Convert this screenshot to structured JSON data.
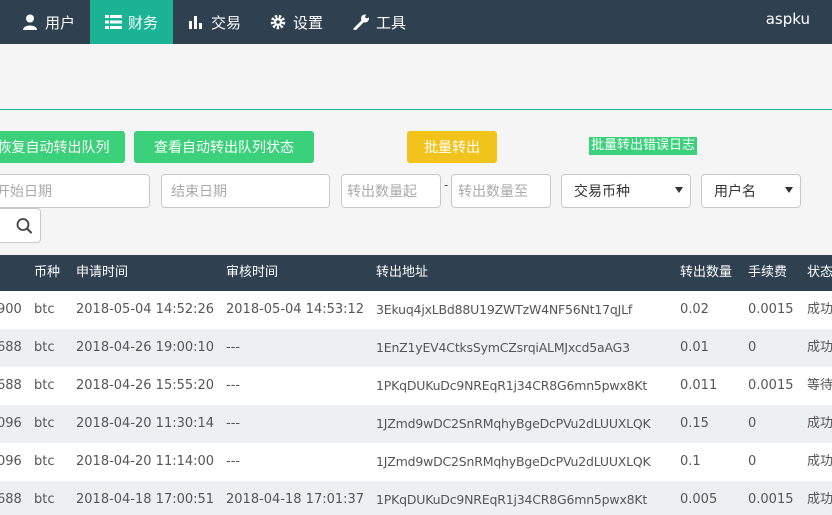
{
  "nav": {
    "items": [
      {
        "label": "用户",
        "icon": "user-icon"
      },
      {
        "label": "财务",
        "icon": "list-icon",
        "active": true
      },
      {
        "label": "交易",
        "icon": "bar-chart-icon"
      },
      {
        "label": "设置",
        "icon": "gear-icon"
      },
      {
        "label": "工具",
        "icon": "wrench-icon"
      }
    ],
    "user": "aspku"
  },
  "toolbar": {
    "resume_queue": "恢复自动转出队列",
    "view_queue_status": "查看自动转出队列状态",
    "batch_transfer": "批量转出",
    "batch_error_log": "批量转出错误日志"
  },
  "filters": {
    "start_date_placeholder": "开始日期",
    "end_date_placeholder": "结束日期",
    "amount_from_placeholder": "转出数量起",
    "amount_to_placeholder": "转出数量至",
    "range_dash": "-",
    "coin_select": "交易币种",
    "user_select": "用户名"
  },
  "colors": {
    "nav_bg": "#2f4050",
    "active_tab": "#1ab394",
    "green_button": "#3bd07a",
    "yellow_button": "#f2c31b"
  },
  "table": {
    "headers": [
      "币种",
      "申请时间",
      "审核时间",
      "转出地址",
      "转出数量",
      "手续费",
      "状态"
    ],
    "rows": [
      {
        "uid": "900",
        "coin": "btc",
        "apply_time": "2018-05-04 14:52:26",
        "review_time": "2018-05-04 14:53:12",
        "address": "3Ekuq4jxLBd88U19ZWTzW4NF56Nt17qJLf",
        "amount": "0.02",
        "fee": "0.0015",
        "status": "成功"
      },
      {
        "uid": "688",
        "coin": "btc",
        "apply_time": "2018-04-26 19:00:10",
        "review_time": "---",
        "address": "1EnZ1yEV4CtksSymCZsrqiALMJxcd5aAG3",
        "amount": "0.01",
        "fee": "0",
        "status": "成功"
      },
      {
        "uid": "688",
        "coin": "btc",
        "apply_time": "2018-04-26 15:55:20",
        "review_time": "---",
        "address": "1PKqDUKuDc9NREqR1j34CR8G6mn5pwx8Kt",
        "amount": "0.011",
        "fee": "0.0015",
        "status": "等待"
      },
      {
        "uid": "096",
        "coin": "btc",
        "apply_time": "2018-04-20 11:30:14",
        "review_time": "---",
        "address": "1JZmd9wDC2SnRMqhyBgeDcPVu2dLUUXLQK",
        "amount": "0.15",
        "fee": "0",
        "status": "成功"
      },
      {
        "uid": "096",
        "coin": "btc",
        "apply_time": "2018-04-20 11:14:00",
        "review_time": "---",
        "address": "1JZmd9wDC2SnRMqhyBgeDcPVu2dLUUXLQK",
        "amount": "0.1",
        "fee": "0",
        "status": "成功"
      },
      {
        "uid": "688",
        "coin": "btc",
        "apply_time": "2018-04-18 17:00:51",
        "review_time": "2018-04-18 17:01:37",
        "address": "1PKqDUKuDc9NREqR1j34CR8G6mn5pwx8Kt",
        "amount": "0.005",
        "fee": "0.0015",
        "status": "成功"
      }
    ]
  }
}
